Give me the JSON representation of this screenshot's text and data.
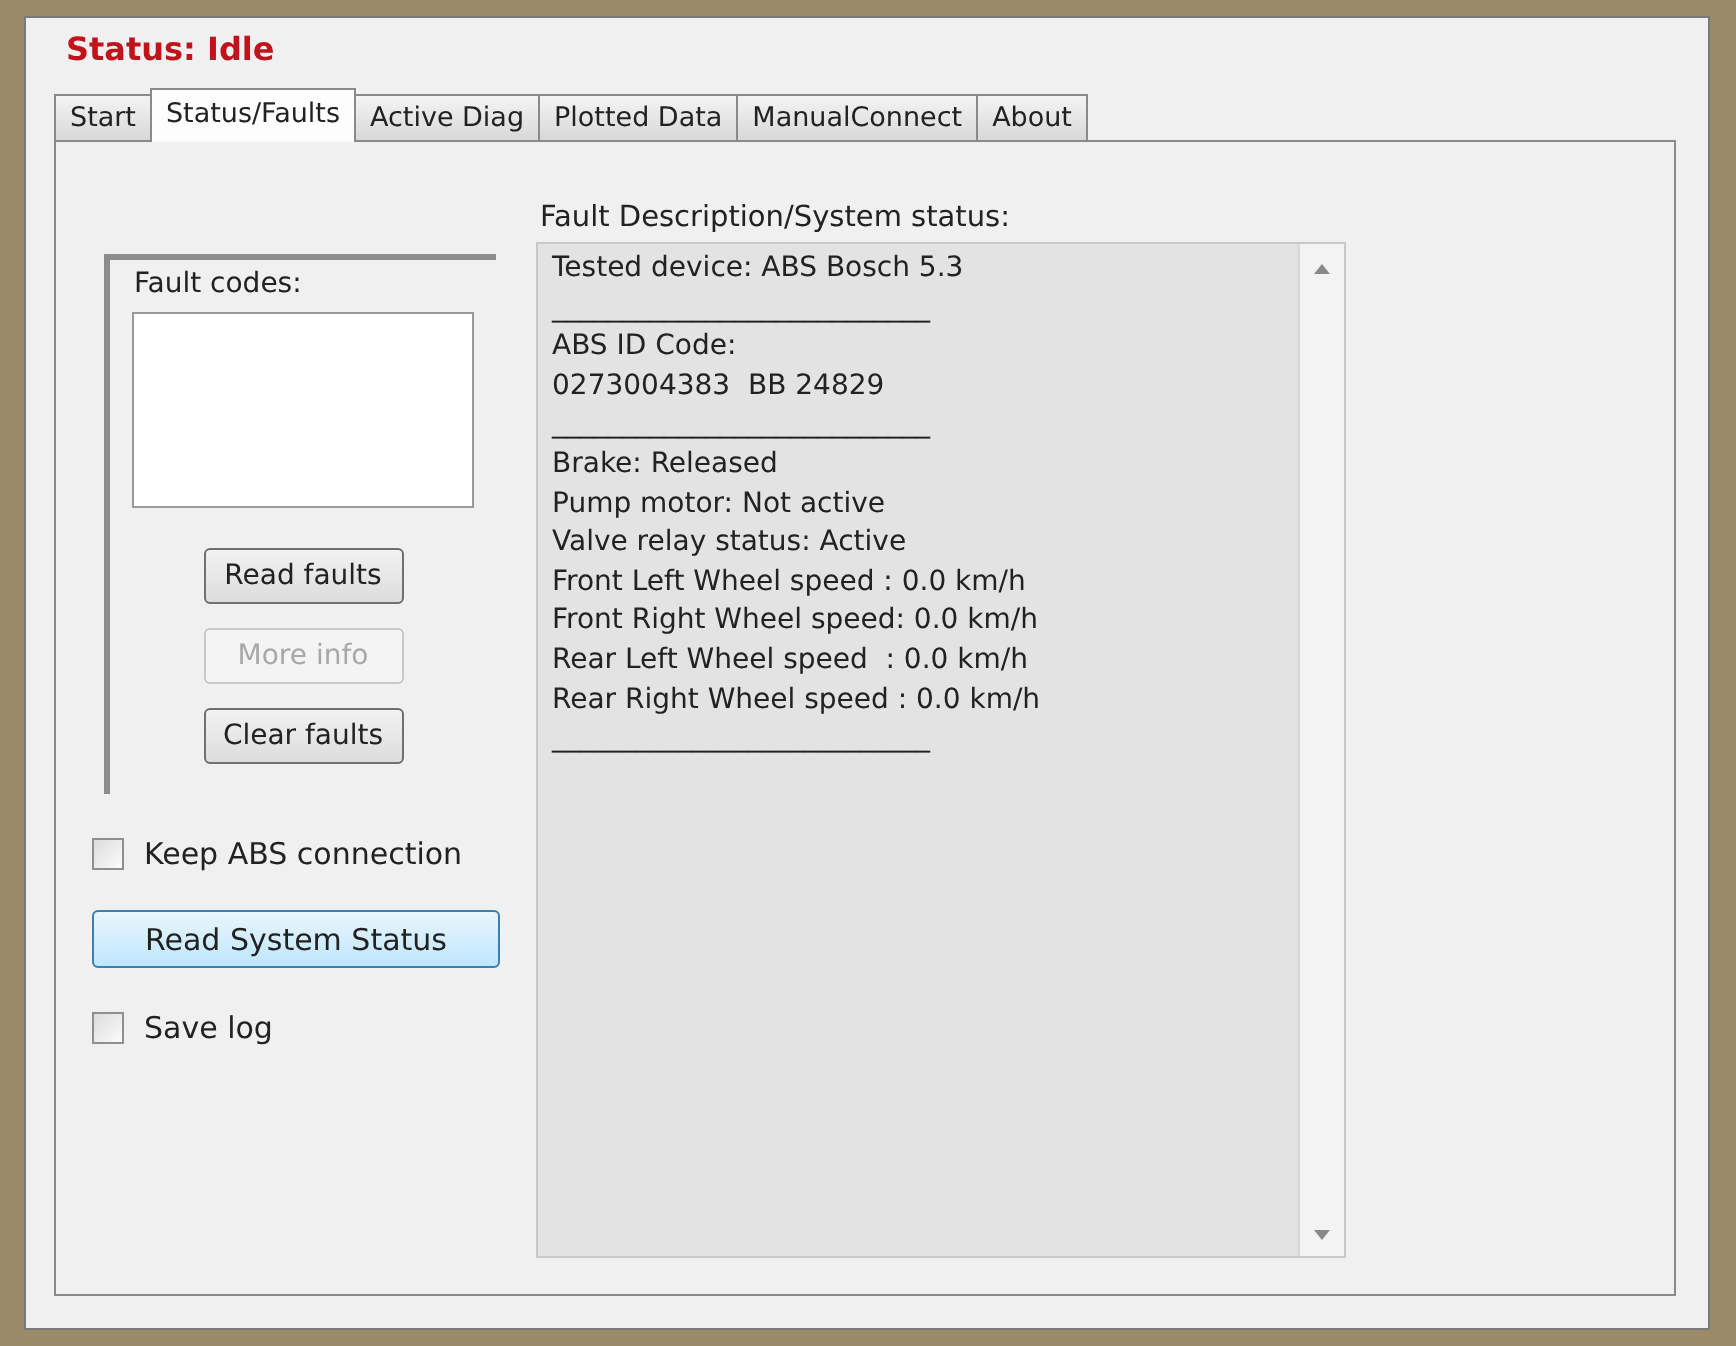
{
  "status": {
    "title": "Status: Idle"
  },
  "tabs": [
    {
      "label": "Start",
      "selected": false
    },
    {
      "label": "Status/Faults",
      "selected": true
    },
    {
      "label": "Active Diag",
      "selected": false
    },
    {
      "label": "Plotted Data",
      "selected": false
    },
    {
      "label": "ManualConnect",
      "selected": false
    },
    {
      "label": "About",
      "selected": false
    }
  ],
  "fault_codes": {
    "label": "Fault codes:",
    "buttons": [
      {
        "label": "Read faults",
        "disabled": false
      },
      {
        "label": "More info",
        "disabled": true
      },
      {
        "label": "Clear faults",
        "disabled": false
      }
    ]
  },
  "keep_connection": {
    "label": "Keep ABS connection",
    "checked": false
  },
  "read_status_button": "Read System Status",
  "save_log": {
    "label": "Save log",
    "checked": false
  },
  "description": {
    "label": "Fault Description/System status:",
    "lines": [
      [
        "Tested device: ABS Bosch 5.3"
      ],
      [
        "___________________________",
        "ABS ID Code:",
        "0273004383  BB 24829"
      ],
      [
        "___________________________",
        "Brake: Released",
        "Pump motor: Not active",
        "Valve relay status: Active",
        "Front Left Wheel speed : 0.0 km/h",
        "Front Right Wheel speed: 0.0 km/h",
        "Rear Left Wheel speed  : 0.0 km/h",
        "Rear Right Wheel speed : 0.0 km/h"
      ],
      [
        "___________________________"
      ]
    ]
  }
}
